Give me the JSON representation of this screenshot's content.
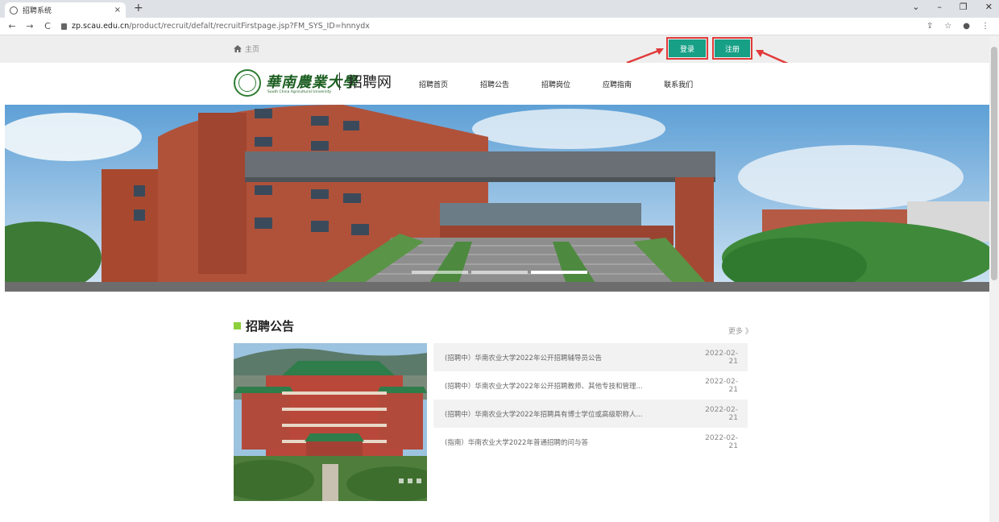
{
  "browser": {
    "tab_title": "招聘系统",
    "tab_close": "×",
    "new_tab": "+",
    "url_domain": "zp.scau.edu.cn",
    "url_path": "/product/recruit/defalt/recruitFirstpage.jsp?FM_SYS_ID=hnnydx",
    "back": "←",
    "forward": "→",
    "reload": "C",
    "win_min": "–",
    "win_restore": "❐",
    "win_close": "✕",
    "win_chevron": "⌄",
    "share": "⇪",
    "star": "☆",
    "profile": "●",
    "menu": "⋮"
  },
  "topbar": {
    "home_label": "主页",
    "login_label": "登录",
    "register_label": "注册"
  },
  "header": {
    "logo_cn": "華南農業大學",
    "logo_en": "South China Agricultural University",
    "site_name": "招聘网",
    "nav": [
      "招聘首页",
      "招聘公告",
      "招聘岗位",
      "应聘指南",
      "联系我们"
    ]
  },
  "section": {
    "title": "招聘公告",
    "more": "更多 》"
  },
  "news": [
    {
      "title": "(招聘中）华南农业大学2022年公开招聘辅导员公告",
      "date": "2022-02-21"
    },
    {
      "title": "(招聘中）华南农业大学2022年公开招聘教师、其他专技和管理...",
      "date": "2022-02-21"
    },
    {
      "title": "(招聘中）华南农业大学2022年招聘具有博士学位或高级职称人...",
      "date": "2022-02-21"
    },
    {
      "title": "(指南）华南农业大学2022年普通招聘的问与答",
      "date": "2022-02-21"
    }
  ],
  "colors": {
    "accent": "#17a086",
    "highlight": "#e23a3a",
    "section_square": "#8ccf3a"
  }
}
